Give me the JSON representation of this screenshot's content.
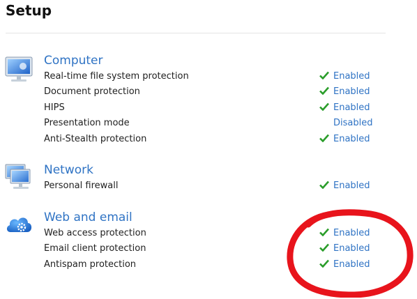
{
  "page": {
    "title": "Setup"
  },
  "sections": [
    {
      "title": "Computer",
      "icon": "computer-monitor-icon",
      "items": [
        {
          "label": "Real-time file system protection",
          "status": "Enabled",
          "enabled": true
        },
        {
          "label": "Document protection",
          "status": "Enabled",
          "enabled": true
        },
        {
          "label": "HIPS",
          "status": "Enabled",
          "enabled": true
        },
        {
          "label": "Presentation mode",
          "status": "Disabled",
          "enabled": false
        },
        {
          "label": "Anti-Stealth protection",
          "status": "Enabled",
          "enabled": true
        }
      ]
    },
    {
      "title": "Network",
      "icon": "network-monitors-icon",
      "items": [
        {
          "label": "Personal firewall",
          "status": "Enabled",
          "enabled": true
        }
      ]
    },
    {
      "title": "Web and email",
      "icon": "cloud-gear-icon",
      "items": [
        {
          "label": "Web access protection",
          "status": "Enabled",
          "enabled": true
        },
        {
          "label": "Email client protection",
          "status": "Enabled",
          "enabled": true
        },
        {
          "label": "Antispam protection",
          "status": "Enabled",
          "enabled": true
        }
      ]
    }
  ],
  "colors": {
    "link": "#2f73c4",
    "check": "#2a9d2a",
    "annotation": "#e8141c"
  }
}
